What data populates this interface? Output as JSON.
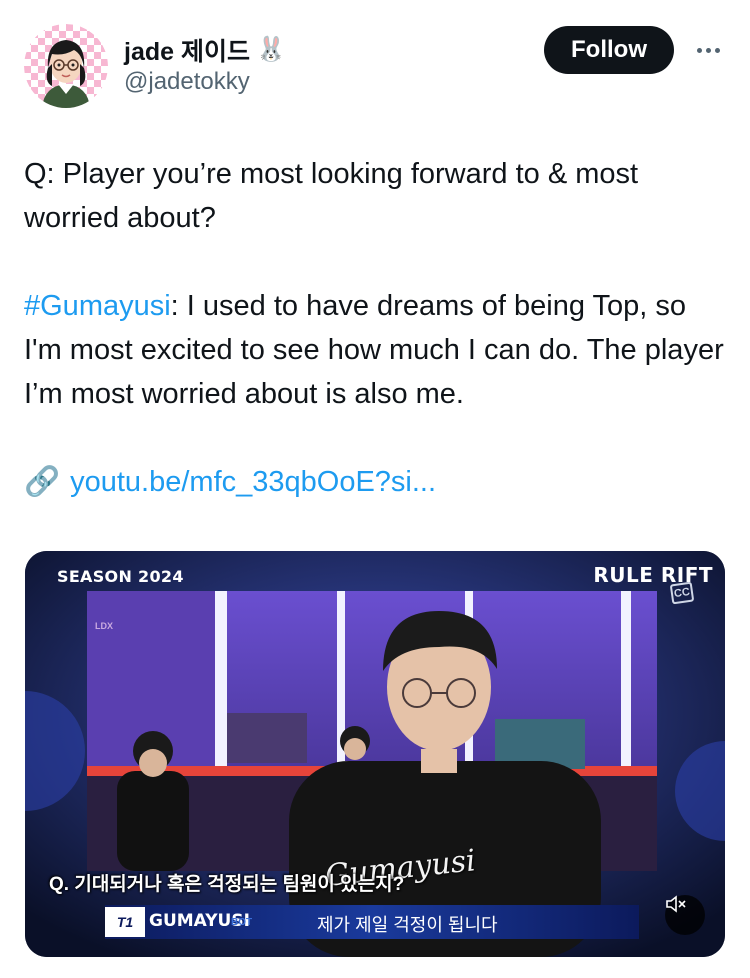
{
  "author": {
    "display_name": "jade 제이드",
    "name_emoji": "🐰",
    "handle": "@jadetokky"
  },
  "actions": {
    "follow_label": "Follow",
    "more_icon": "more-horizontal-icon"
  },
  "tweet": {
    "line1": "Q: Player you’re most looking forward to & most worried about?",
    "hashtag": "#Gumayusi",
    "answer": ": I used to have dreams of being Top, so I'm most excited to see how much I can do. The player I’m most worried about is also me.",
    "link_icon": "🔗",
    "link_text": "youtu.be/mfc_33qbOoE?si..."
  },
  "media": {
    "season_label": "SEASON 2024",
    "rift_label": "RULE RIFT",
    "cc_label": "CC",
    "ldx_label": "LDX",
    "question_caption": "Q. 기대되거나 혹은 걱정되는 팀원이 있는지?",
    "jersey_text": "Gumayusi",
    "team_logo_text": "T1",
    "player_name": "GUMAYUSI",
    "player_role": "BOT",
    "subtitle": "제가 제일 걱정이 됩니다",
    "mute_icon": "volume-muted-icon"
  }
}
